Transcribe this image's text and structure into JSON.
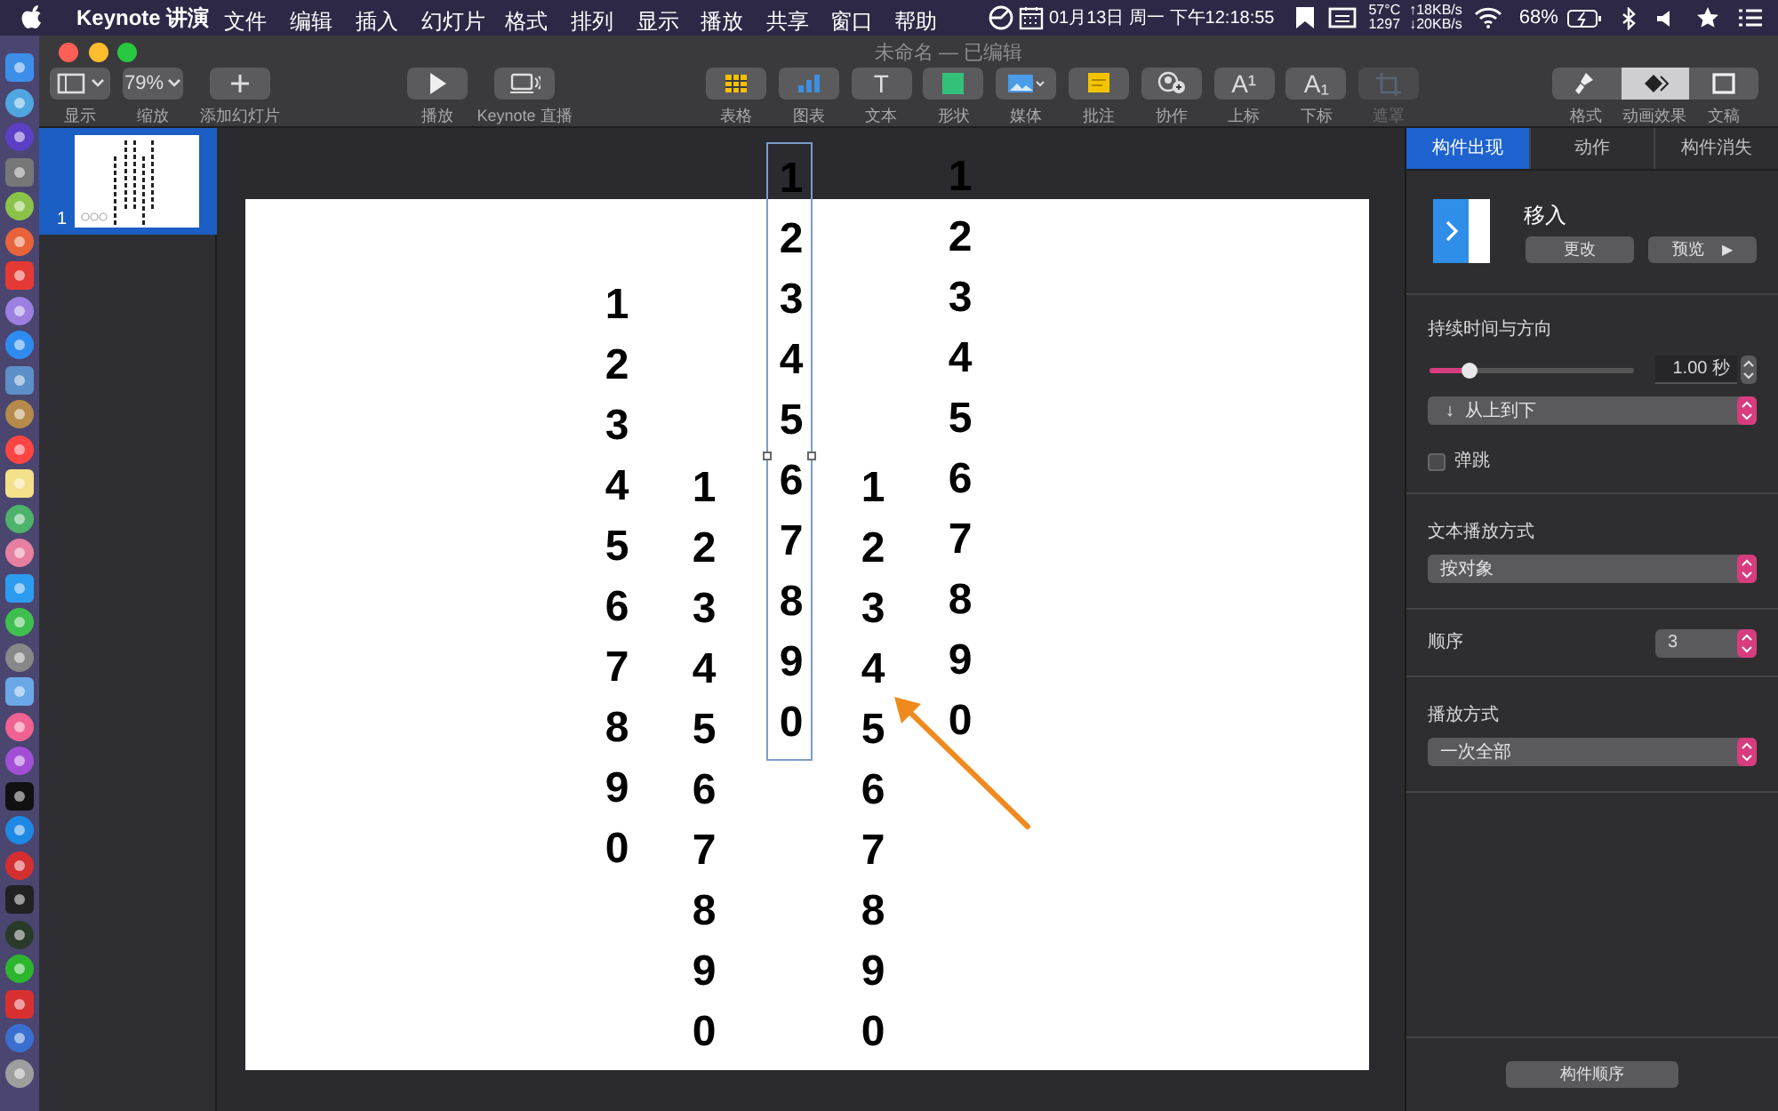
{
  "menu_bar": {
    "app_name": "Keynote 讲演",
    "menus": [
      "文件",
      "编辑",
      "插入",
      "幻灯片",
      "格式",
      "排列",
      "显示",
      "播放",
      "共享",
      "窗口",
      "帮助"
    ],
    "clock": "01月13日 周一 下午12:18:55",
    "sensors": [
      "57°C",
      "1297"
    ],
    "network": [
      "↑18KB/s",
      "↓20KB/s"
    ],
    "battery": "68%"
  },
  "window": {
    "title": "未命名 — 已编辑"
  },
  "toolbar": {
    "groups": [
      [
        {
          "kind": "view",
          "label": "显示"
        },
        {
          "kind": "zoom",
          "label": "缩放",
          "value": "79%"
        },
        {
          "kind": "add",
          "label": "添加幻灯片"
        }
      ],
      [
        {
          "kind": "play",
          "label": "播放"
        },
        {
          "kind": "live",
          "label": "Keynote 直播"
        }
      ],
      [
        {
          "kind": "table",
          "label": "表格",
          "disabled": false
        },
        {
          "kind": "chart",
          "label": "图表",
          "disabled": false
        },
        {
          "kind": "text",
          "label": "文本",
          "glyph": "T",
          "disabled": false
        },
        {
          "kind": "shape",
          "label": "形状",
          "disabled": false
        },
        {
          "kind": "media",
          "label": "媒体",
          "disabled": false
        },
        {
          "kind": "comment",
          "label": "批注",
          "disabled": false
        },
        {
          "kind": "collaborate",
          "label": "协作",
          "disabled": false
        },
        {
          "kind": "superscript",
          "label": "上标",
          "glyph": "A¹",
          "disabled": false
        },
        {
          "kind": "subscript",
          "label": "下标",
          "glyph": "A₁",
          "disabled": false
        },
        {
          "kind": "mask",
          "label": "遮罩",
          "disabled": true
        }
      ]
    ],
    "inspector_tabs": [
      {
        "kind": "format",
        "label": "格式",
        "selected": false
      },
      {
        "kind": "animate",
        "label": "动画效果",
        "selected": true
      },
      {
        "kind": "document",
        "label": "文稿",
        "selected": false
      }
    ]
  },
  "navigator": {
    "slides": [
      {
        "number": "1",
        "selected": true
      }
    ]
  },
  "slide": {
    "columns": [
      {
        "text": "1234567890",
        "selected": false
      },
      {
        "text": "1234567890",
        "selected": false
      },
      {
        "text": "1234567890",
        "selected": true
      },
      {
        "text": "1234567890",
        "selected": false
      },
      {
        "text": "1234567890",
        "selected": false
      }
    ]
  },
  "animate_panel": {
    "tabs": [
      {
        "label": "构件出现",
        "selected": true
      },
      {
        "label": "动作",
        "selected": false
      },
      {
        "label": "构件消失",
        "selected": false
      }
    ],
    "effect": {
      "name": "移入",
      "buttons": [
        {
          "label": "更改"
        },
        {
          "label": "预览",
          "glyph": "▶"
        }
      ]
    },
    "duration": {
      "label": "持续时间与方向",
      "level": 0.19,
      "value": "1.00 秒"
    },
    "direction": {
      "glyph": "↓",
      "value": "从上到下"
    },
    "bounce": {
      "label": "弹跳",
      "checked": false
    },
    "text_delivery": {
      "label": "文本播放方式",
      "value": "按对象"
    },
    "order": {
      "label": "顺序",
      "value": "3"
    },
    "delivery": {
      "label": "播放方式",
      "value": "一次全部"
    },
    "build_order_button": "构件顺序"
  }
}
